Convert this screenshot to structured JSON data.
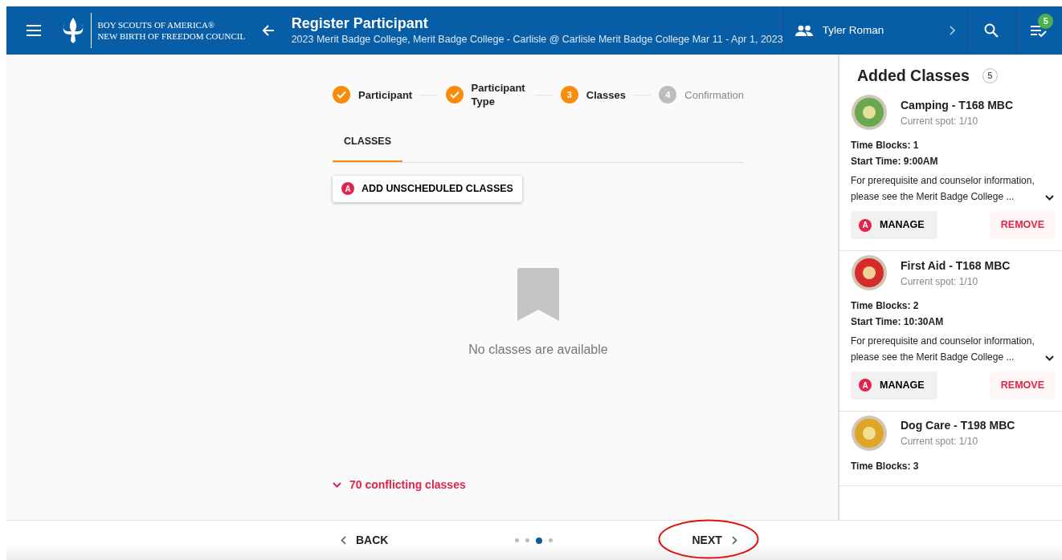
{
  "header": {
    "org_line_1": "BOY SCOUTS OF AMERICA®",
    "org_line_2": "NEW BIRTH OF FREEDOM COUNCIL",
    "title": "Register Participant",
    "subtitle": "2023 Merit Badge College, Merit Badge College - Carlisle @ Carlisle Merit Badge College Mar 11 - Apr 1, 2023",
    "user": "Tyler Roman",
    "notification_count": "5"
  },
  "stepper": [
    {
      "label": "Participant",
      "kind": "done"
    },
    {
      "label": "Participant Type",
      "kind": "done"
    },
    {
      "label": "Classes",
      "number": "3",
      "kind": "current"
    },
    {
      "label": "Confirmation",
      "number": "4",
      "kind": "upcoming"
    }
  ],
  "tabs": [
    {
      "label": "CLASSES",
      "selected": true
    }
  ],
  "add_button": {
    "badge": "A",
    "label": "ADD UNSCHEDULED CLASSES"
  },
  "empty_message": "No classes are available",
  "conflicts": {
    "label": "70 conflicting classes",
    "expanded": false
  },
  "added_classes": {
    "title": "Added Classes",
    "count": "5",
    "items": [
      {
        "name": "Camping - T168 MBC",
        "spot": "Current spot: 1/10",
        "color": "#6aa84f",
        "time_blocks": "Time Blocks: 1",
        "start_time": "Start Time: 9:00AM",
        "description": "For prerequisite and counselor information, please see the Merit Badge College ...",
        "expanded": false,
        "manage_badge": "A",
        "manage": "MANAGE",
        "remove": "REMOVE"
      },
      {
        "name": "First Aid - T168 MBC",
        "spot": "Current spot: 1/10",
        "color": "#d62b2b",
        "time_blocks": "Time Blocks: 2",
        "start_time": "Start Time: 10:30AM",
        "description": "For prerequisite and counselor information, please see the Merit Badge College ...",
        "expanded": false,
        "manage_badge": "A",
        "manage": "MANAGE",
        "remove": "REMOVE"
      },
      {
        "name": "Dog Care - T198 MBC",
        "spot": "Current spot: 1/10",
        "color": "#e0a526",
        "time_blocks": "Time Blocks: 3"
      }
    ]
  },
  "footer": {
    "back": "BACK",
    "next": "NEXT",
    "pages": [
      {
        "selected": false
      },
      {
        "selected": false
      },
      {
        "selected": true
      },
      {
        "selected": false
      }
    ]
  }
}
